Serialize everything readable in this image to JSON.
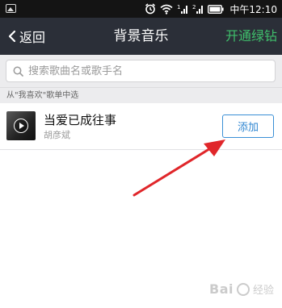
{
  "status_bar": {
    "time": "中午12:10",
    "icons": [
      "gallery-icon",
      "alarm-icon",
      "wifi-icon",
      "signal-1-icon",
      "signal-2-icon",
      "battery-icon"
    ]
  },
  "nav": {
    "back_label": "返回",
    "title": "背景音乐",
    "vip_label": "开通绿钻"
  },
  "search": {
    "placeholder": "搜索歌曲名或歌手名"
  },
  "section": {
    "header": "从\"我喜欢\"歌单中选"
  },
  "songs": [
    {
      "title": "当爱已成往事",
      "artist": "胡彦斌",
      "action_label": "添加"
    }
  ],
  "colors": {
    "nav_bg": "#2b2f38",
    "vip_green": "#3fbf6c",
    "add_blue": "#2f86d1",
    "arrow_red": "#e0262a"
  },
  "watermark": {
    "logo": "Bai",
    "sub": "经验"
  }
}
